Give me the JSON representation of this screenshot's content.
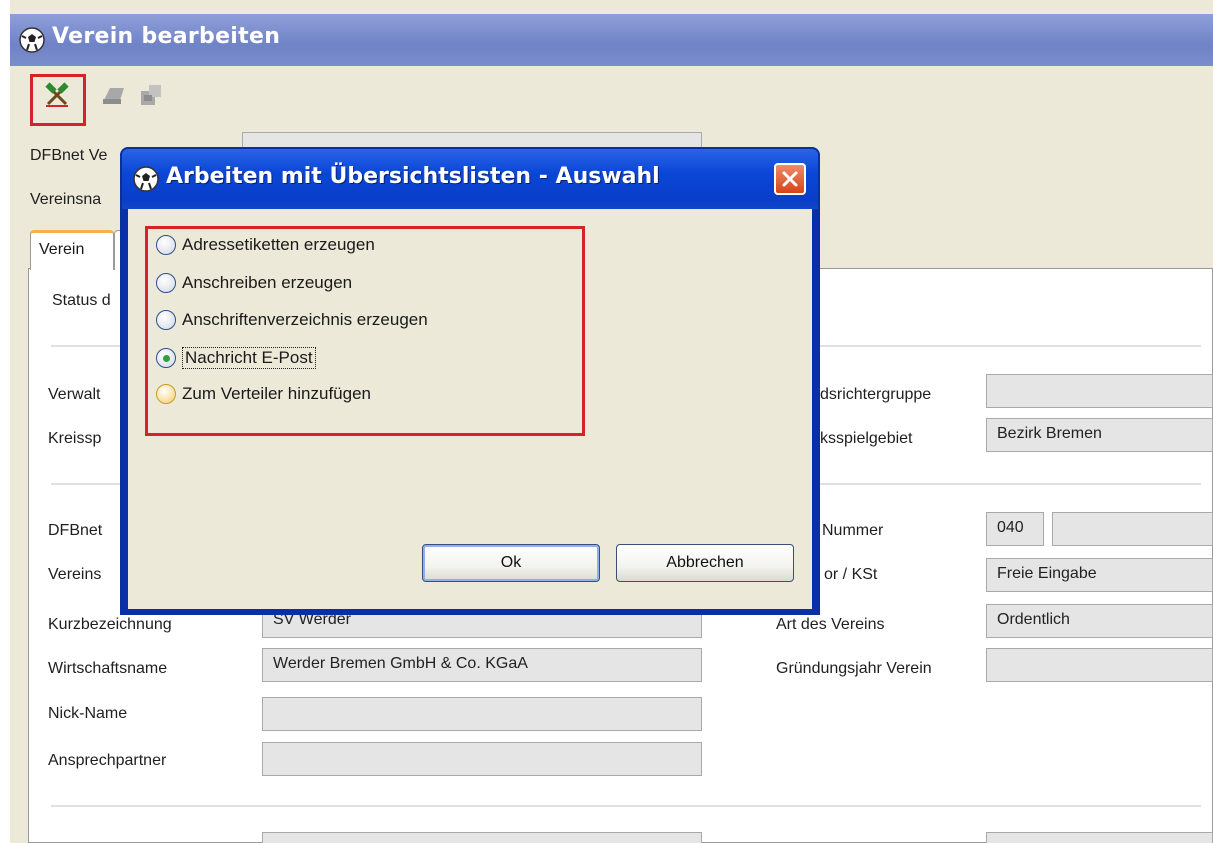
{
  "window": {
    "title": "Verein bearbeiten"
  },
  "form": {
    "labels": {
      "dfbnet_verein": "DFBnet Ve",
      "vereinsname": "Vereinsna",
      "status": "Status d",
      "verwaltung": "Verwalt",
      "kreisspiel": "Kreissp",
      "dfbnet2": "DFBnet",
      "vereins": "Vereins",
      "kurzbezeichnung": "Kurzbezeichnung",
      "wirtschaftsname": "Wirtschaftsname",
      "nick_name": "Nick-Name",
      "ansprechpartner": "Ansprechpartner",
      "schiedsrichtergruppe": "dsrichtergruppe",
      "bezirksspielgebiet": "ksspielgebiet",
      "nummer": "Nummer",
      "kst": "or / KSt",
      "art_des_vereins": "Art des Vereins",
      "gruendungsjahr": "Gründungsjahr Verein"
    },
    "values": {
      "dfbnet_verein": "",
      "kurzbezeichnung": "SV Werder",
      "wirtschaftsname": "Werder Bremen GmbH & Co. KGaA",
      "nick_name": "",
      "ansprechpartner": "",
      "bezirksspielgebiet": "Bezirk Bremen",
      "nummer_prefix": "040",
      "kst": "Freie Eingabe",
      "art_des_vereins": "Ordentlich",
      "gruendungsjahr": ""
    },
    "tabs": [
      {
        "label": "Verein",
        "active": true
      },
      {
        "label": "",
        "active": false
      }
    ]
  },
  "dialog": {
    "title": "Arbeiten mit Übersichtslisten - Auswahl",
    "options": [
      {
        "label": "Adressetiketten erzeugen",
        "checked": false
      },
      {
        "label": "Anschreiben erzeugen",
        "checked": false
      },
      {
        "label": "Anschriftenverzeichnis erzeugen",
        "checked": false
      },
      {
        "label": "Nachricht E-Post",
        "checked": true
      },
      {
        "label": "Zum Verteiler hinzufügen",
        "checked": false
      }
    ],
    "ok_label": "Ok",
    "cancel_label": "Abbrechen"
  },
  "colors": {
    "highlight": "#d4242a",
    "dialog_title": "#0a47d6",
    "window_title": "#7a8dcc"
  },
  "icons": [
    "soccer-ball-icon",
    "tools-icon",
    "printer-icon",
    "export-icon",
    "close-icon"
  ]
}
